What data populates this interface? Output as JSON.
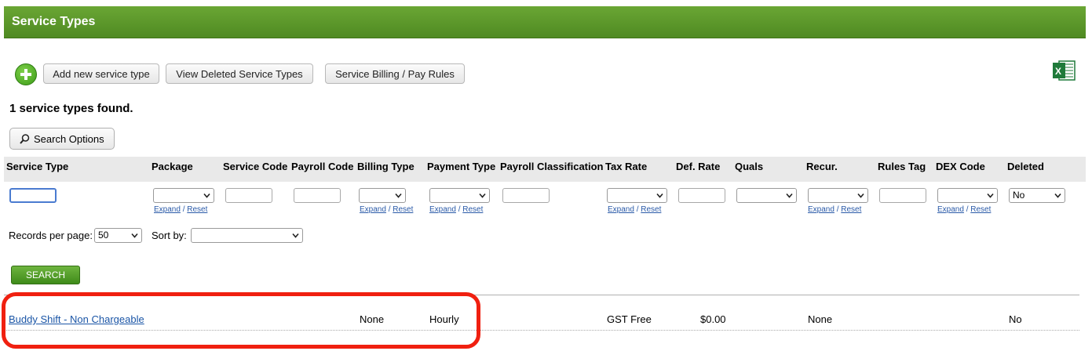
{
  "page": {
    "title": "Service Types"
  },
  "toolbar": {
    "add_label": "Add new service type",
    "deleted_label": "View Deleted Service Types",
    "billing_label": "Service Billing / Pay Rules"
  },
  "result_summary": "1 service types found.",
  "search_options_label": "Search Options",
  "columns": [
    "Service Type",
    "Package",
    "Service Code",
    "Payroll Code",
    "Billing Type",
    "Payment Type",
    "Payroll Classification",
    "Tax Rate",
    "Def. Rate",
    "Quals",
    "Recur.",
    "Rules Tag",
    "DEX Code",
    "Deleted"
  ],
  "filters": {
    "expand_label": "Expand",
    "reset_label": "Reset",
    "sep": "/",
    "deleted_value": "No"
  },
  "paging": {
    "records_label": "Records per page:",
    "records_value": "50",
    "sort_label": "Sort by:",
    "sort_value": ""
  },
  "search_button": "SEARCH",
  "rows": [
    {
      "service_type": "Buddy Shift - Non Chargeable",
      "billing_type": "None",
      "payment_type": "Hourly",
      "tax_rate": "GST Free",
      "def_rate": "$0.00",
      "recur": "None",
      "deleted": "No"
    }
  ],
  "icons": {
    "add": "plus-circle-icon",
    "excel": "excel-export-icon",
    "search": "magnifier-icon"
  },
  "colors": {
    "header": "#5a9628",
    "highlight": "#f02010",
    "link": "#1a55a6"
  }
}
